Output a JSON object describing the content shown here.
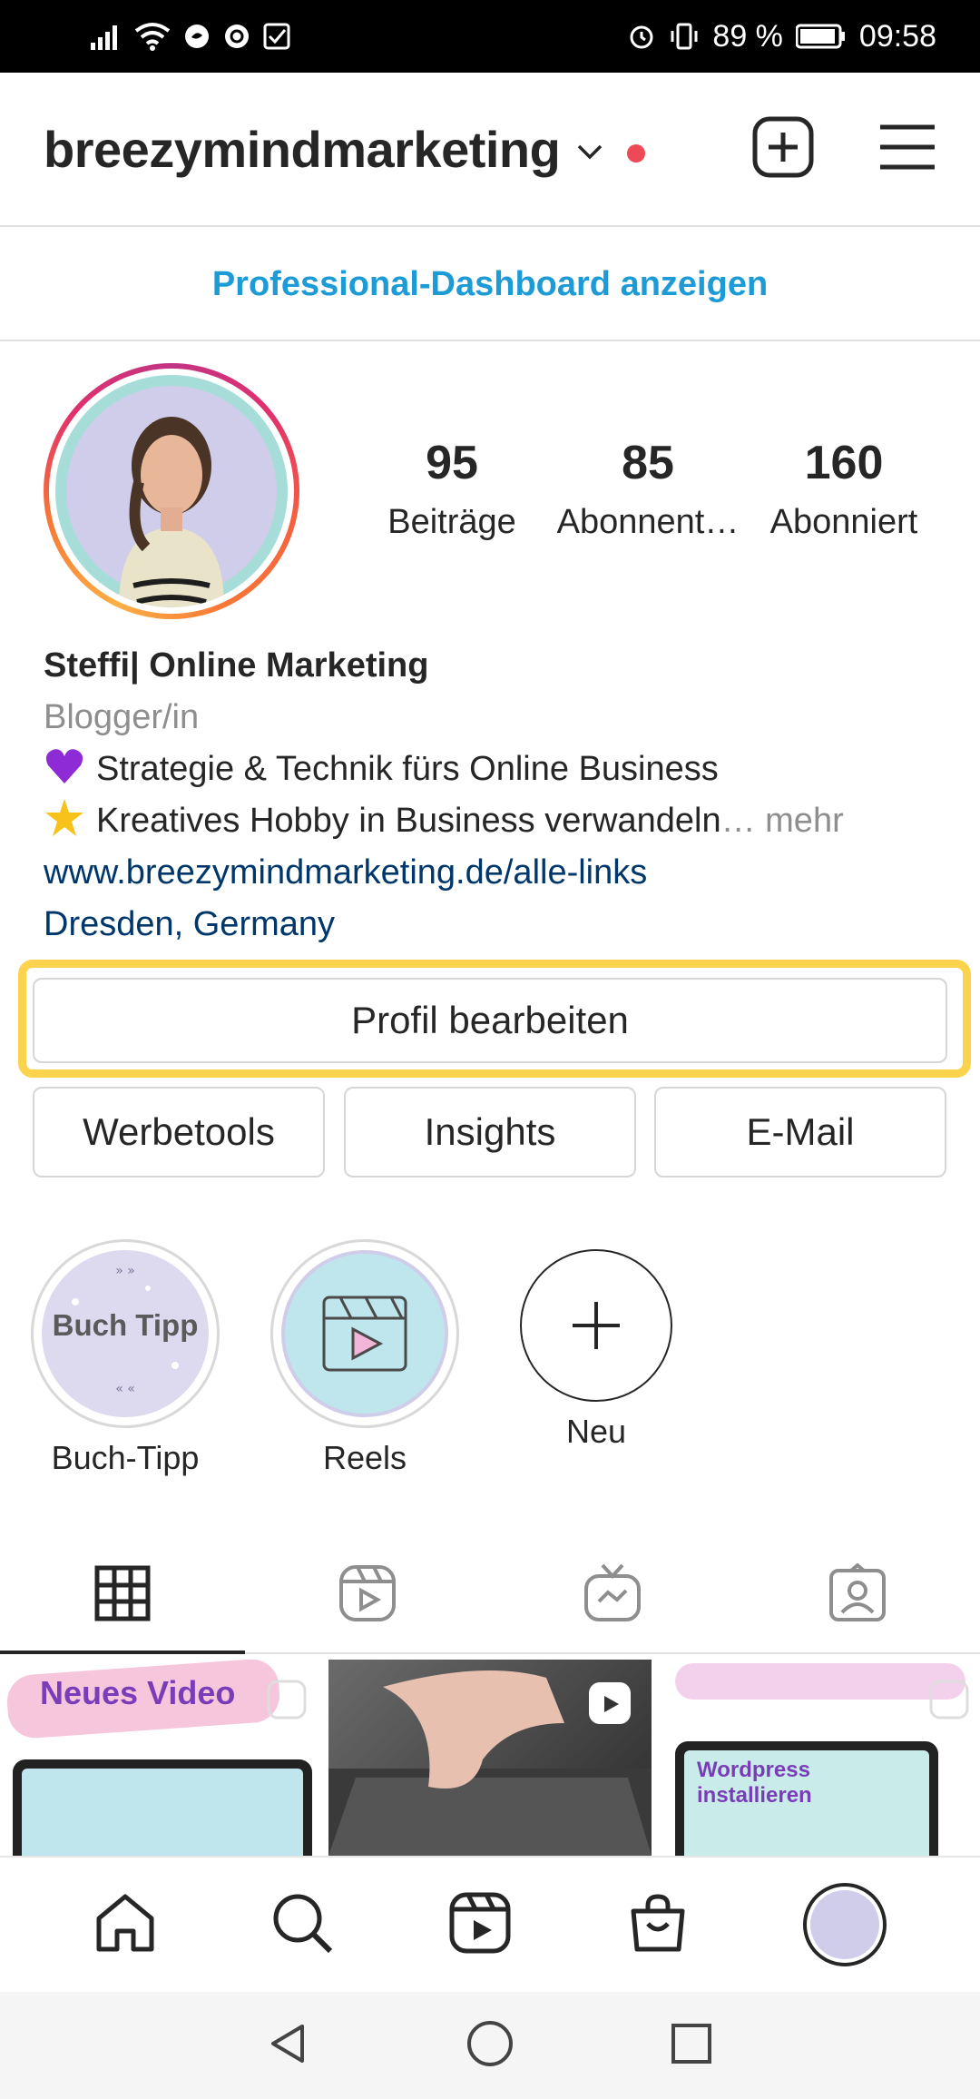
{
  "status_bar": {
    "battery": "89 %",
    "time": "09:58"
  },
  "header": {
    "username": "breezymindmarketing"
  },
  "dashboard_link": "Professional-Dashboard anzeigen",
  "stats": [
    {
      "num": "95",
      "label": "Beiträge"
    },
    {
      "num": "85",
      "label": "Abonnent…"
    },
    {
      "num": "160",
      "label": "Abonniert"
    }
  ],
  "bio": {
    "name": "Steffi| Online Marketing",
    "category": "Blogger/in",
    "line1": "Strategie & Technik fürs Online Business",
    "line2": "Kreatives Hobby in Business verwandeln",
    "more": "… mehr",
    "link": "www.breezymindmarketing.de/alle-links",
    "location": "Dresden, Germany"
  },
  "buttons": {
    "edit_profile": "Profil bearbeiten",
    "ad_tools": "Werbetools",
    "insights": "Insights",
    "email": "E-Mail"
  },
  "highlights": [
    {
      "label": "Buch-Tipp",
      "cover_text": "Buch Tipp"
    },
    {
      "label": "Reels"
    },
    {
      "label": "Neu"
    }
  ],
  "grid_posts": [
    {
      "title": "Neues Video"
    },
    {
      "title": ""
    },
    {
      "title": "Wordpress installieren"
    }
  ],
  "colors": {
    "accent_link": "#1d9bd7",
    "highlight_box": "#fcd34d",
    "notification_dot": "#ed4956"
  }
}
